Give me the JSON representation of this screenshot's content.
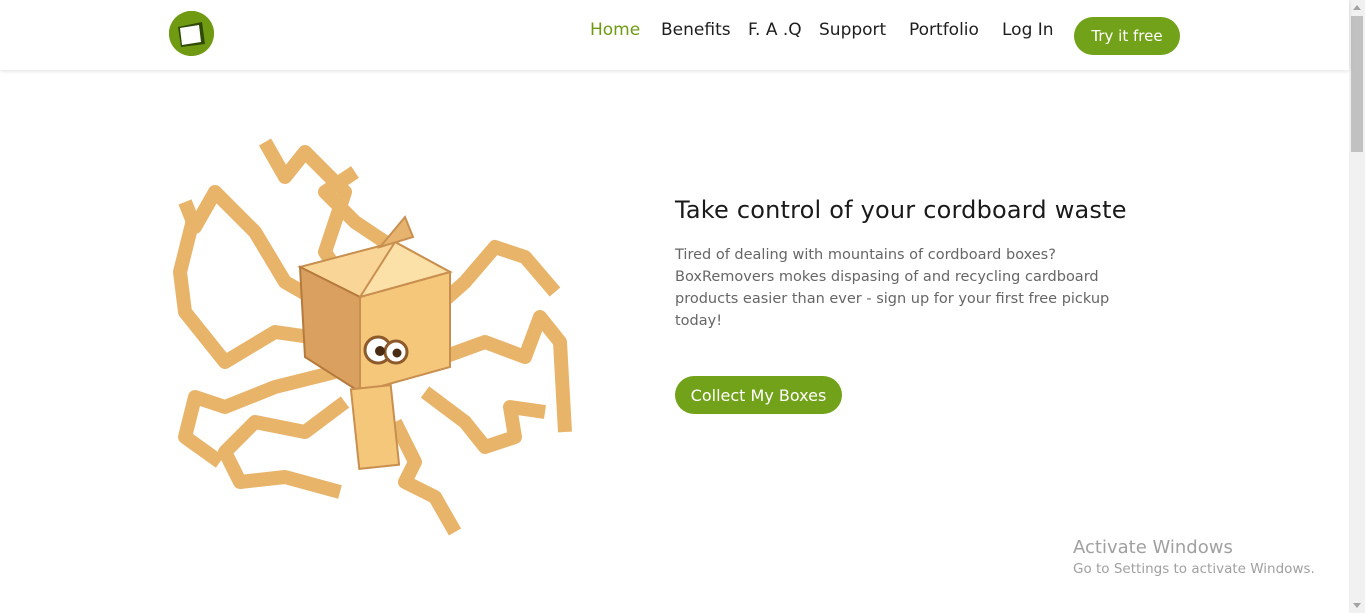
{
  "header": {
    "logo_icon": "box-logo-icon",
    "nav": [
      {
        "label": "Home",
        "active": true
      },
      {
        "label": "Benefits",
        "active": false
      },
      {
        "label": "F. A .Q",
        "active": false
      },
      {
        "label": "Support",
        "active": false
      },
      {
        "label": "Portfolio",
        "active": false
      },
      {
        "label": "Log In",
        "active": false
      }
    ],
    "cta_label": "Try it free"
  },
  "hero": {
    "illustration_icon": "cardboard-octopus-illustration",
    "title": "Take control of your cordboard waste",
    "text": "Tired of dealing with mountains of cordboard boxes? BoxRemovers mokes dispasing of and recycling cardboard products easier than ever - sign up for your first free pickup today!",
    "button_label": "Collect My Boxes"
  },
  "watermark": {
    "title": "Activate Windows",
    "subtitle": "Go to Settings to activate Windows."
  },
  "colors": {
    "accent": "#72a11a",
    "active_nav": "#6f9a12",
    "cardboard": "#f5c77a",
    "cardboard_dark": "#c78a4d"
  }
}
